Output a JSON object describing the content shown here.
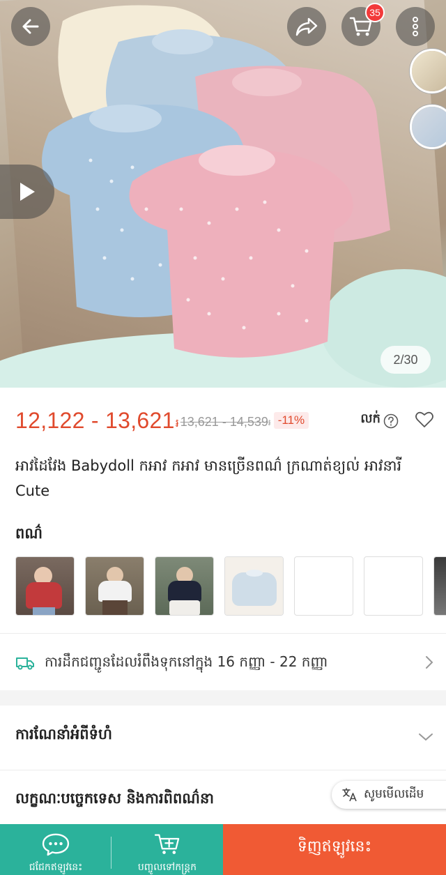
{
  "header": {
    "cart_count": "35",
    "image_counter": "2/30"
  },
  "product": {
    "price": "12,122 - 13,621",
    "currency_symbol": "៛",
    "old_price": "13,621 - 14,539",
    "discount": "-11%",
    "sold_label": "លក់",
    "title": "អាវដៃវែង Babydoll កអាវ កអាវ មានច្រើនពណ៌ ក្រណាត់ខ្យល់ អាវនារី Cute"
  },
  "variants": {
    "label": "ពណ៌"
  },
  "delivery": {
    "text": "ការដឹកជញ្ជូនដែលរំពឹងទុកនៅក្នុង 16 កញ្ញា - 22 កញ្ញា"
  },
  "sections": {
    "size_guide": "ការណែនាំអំពីទំហំ",
    "specs": "លក្ខណៈបច្ចេកទេស និងការពិពណ៌នា"
  },
  "translate": {
    "label": "សូមមើលដើម"
  },
  "bottom_bar": {
    "chat_label": "ជជែកឥឡូវនេះ",
    "add_cart_label": "បញ្ចូលទៅកន្ត្រក",
    "buy_label": "ទិញឥឡូវនេះ"
  },
  "icons": [
    "back-arrow-icon",
    "share-icon",
    "cart-icon",
    "more-icon",
    "play-icon",
    "help-icon",
    "heart-icon",
    "truck-icon",
    "chevron-right-icon",
    "chevron-down-icon",
    "translate-icon",
    "chat-icon",
    "add-cart-icon"
  ],
  "colors": {
    "price": "#e04a2d",
    "accent_green": "#2bb29b",
    "buy_orange": "#f05a34",
    "badge_red": "#f23a3a"
  }
}
